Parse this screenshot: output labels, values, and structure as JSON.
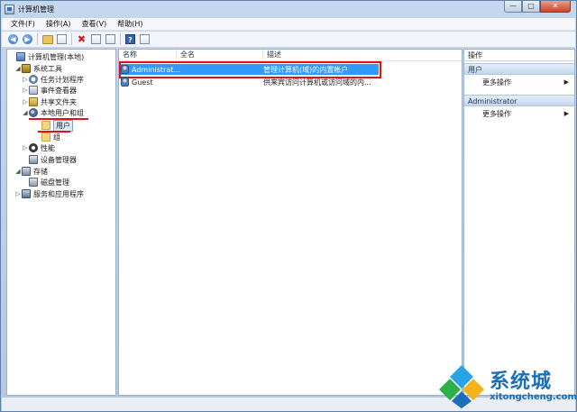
{
  "window": {
    "title": "计算机管理"
  },
  "window_controls": {
    "minimize": "—",
    "maximize": "□",
    "close": "✕"
  },
  "menubar": {
    "items": [
      "文件(F)",
      "操作(A)",
      "查看(V)",
      "帮助(H)"
    ]
  },
  "toolbar": {
    "back_icon": "arrow-left-icon",
    "forward_icon": "arrow-right-icon",
    "up_icon": "folder-up-icon",
    "show_tree_icon": "console-tree-icon",
    "delete_icon": "delete-icon",
    "properties_icon": "properties-icon",
    "export_icon": "export-icon",
    "help_icon": "help-icon",
    "action_pane_icon": "action-pane-icon"
  },
  "tree": {
    "items": [
      {
        "label": "计算机管理(本地)",
        "icon": "computer-icon",
        "expander": ""
      },
      {
        "label": "系统工具",
        "icon": "tools-icon",
        "expander": "◢"
      },
      {
        "label": "任务计划程序",
        "icon": "clock-icon",
        "expander": "▷"
      },
      {
        "label": "事件查看器",
        "icon": "event-log-icon",
        "expander": "▷"
      },
      {
        "label": "共享文件夹",
        "icon": "shared-folder-icon",
        "expander": "▷"
      },
      {
        "label": "本地用户和组",
        "icon": "users-icon",
        "expander": "◢"
      },
      {
        "label": "用户",
        "icon": "folder-icon",
        "expander": ""
      },
      {
        "label": "组",
        "icon": "folder-icon",
        "expander": ""
      },
      {
        "label": "性能",
        "icon": "performance-icon",
        "expander": "▷"
      },
      {
        "label": "设备管理器",
        "icon": "device-manager-icon",
        "expander": ""
      },
      {
        "label": "存储",
        "icon": "storage-icon",
        "expander": "◢"
      },
      {
        "label": "磁盘管理",
        "icon": "disk-icon",
        "expander": ""
      },
      {
        "label": "服务和应用程序",
        "icon": "services-icon",
        "expander": "▷"
      }
    ]
  },
  "list": {
    "columns": [
      "名称",
      "全名",
      "描述"
    ],
    "rows": [
      {
        "name": "Administrat...",
        "fullname": "",
        "description": "管理计算机(域)的内置帐户"
      },
      {
        "name": "Guest",
        "fullname": "",
        "description": "供来宾访问计算机或访问域的内..."
      }
    ]
  },
  "actions": {
    "title": "操作",
    "groups": [
      {
        "header": "用户",
        "items": [
          "更多操作"
        ]
      },
      {
        "header": "Administrator",
        "items": [
          "更多操作"
        ]
      }
    ],
    "arrow": "▶"
  },
  "watermark": {
    "name": "系统城",
    "url": "xitongcheng.com"
  },
  "colors": {
    "selection": "#3399ff",
    "annotation": "#e0101c",
    "brand": "#1a6fb8"
  }
}
